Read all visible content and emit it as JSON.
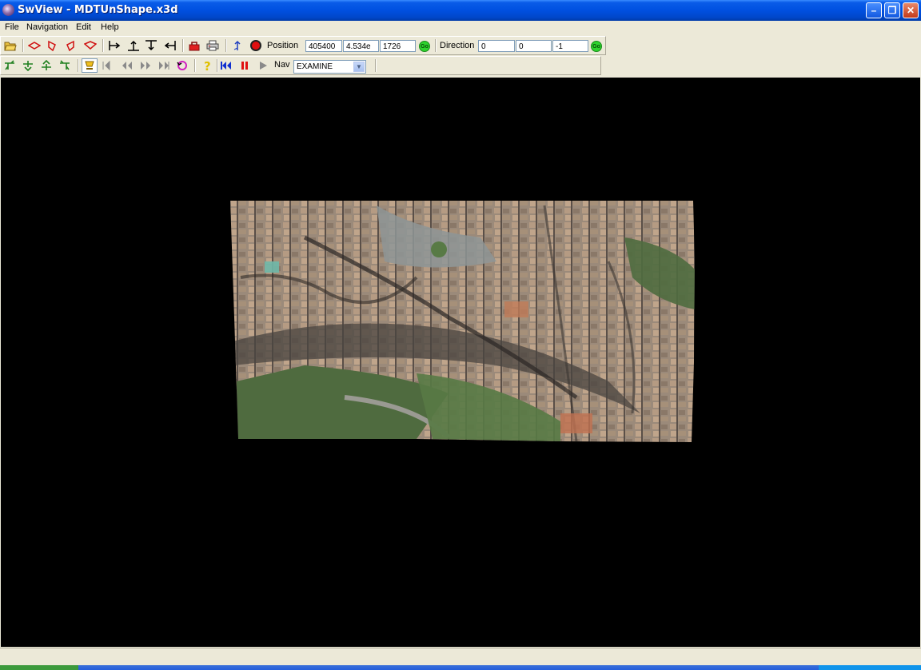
{
  "window": {
    "title": "SwView - MDTUnShape.x3d",
    "minimize_glyph": "–",
    "maximize_glyph": "❐",
    "close_glyph": "✕"
  },
  "menu": {
    "file": "File",
    "navigation": "Navigation",
    "edit": "Edit",
    "help": "Help"
  },
  "toolbar": {
    "position_label": "Position",
    "position_x": "405400",
    "position_y": "4.534e",
    "position_z": "1726",
    "go_label": "Go",
    "direction_label": "Direction",
    "direction_x": "0",
    "direction_y": "0",
    "direction_z": "-1",
    "nav_label": "Nav",
    "nav_mode": "EXAMINE"
  },
  "colors": {
    "titlebar": "#0050E0",
    "face": "#ECE9D8",
    "viewport_bg": "#000000",
    "go_button": "#2ED32E"
  }
}
